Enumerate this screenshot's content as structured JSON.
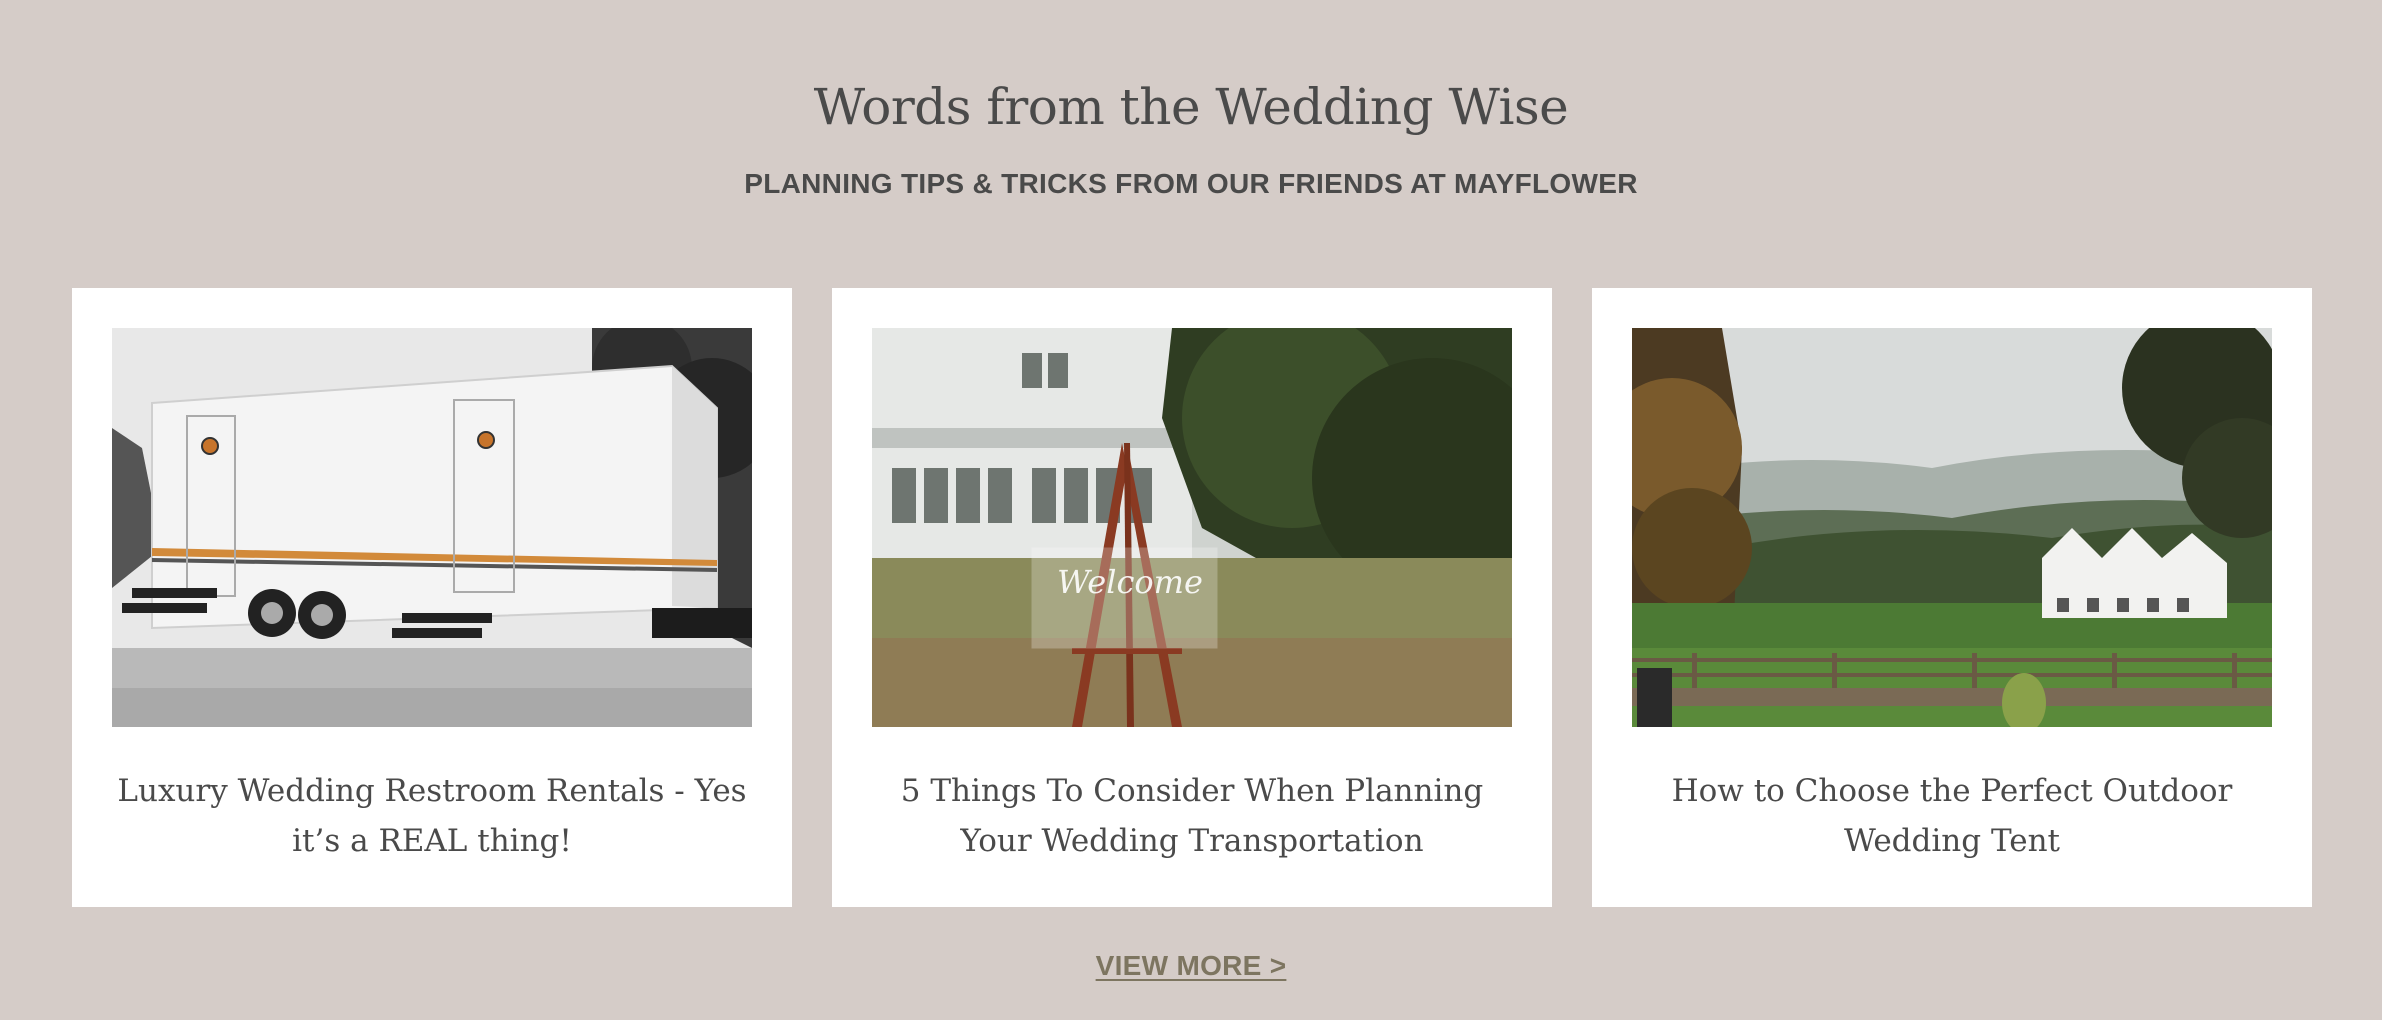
{
  "header": {
    "title": "Words from the Wedding Wise",
    "subtitle": "PLANNING TIPS & TRICKS FROM OUR FRIENDS AT MAYFLOWER"
  },
  "posts": [
    {
      "title": "Luxury Wedding Restroom Rentals - Yes it’s a REAL thing!",
      "image": "restroom-trailer-photo"
    },
    {
      "title": "5 Things To Consider When Planning Your Wedding Transportation",
      "image": "welcome-sign-easel-photo"
    },
    {
      "title": "How to Choose the Perfect Outdoor Wedding Tent",
      "image": "tent-in-field-photo"
    }
  ],
  "footer": {
    "view_more_label": "VIEW MORE >"
  },
  "colors": {
    "background": "#d5ccc8",
    "card": "#ffffff",
    "text": "#4a4a4a",
    "link": "#7d7560"
  }
}
